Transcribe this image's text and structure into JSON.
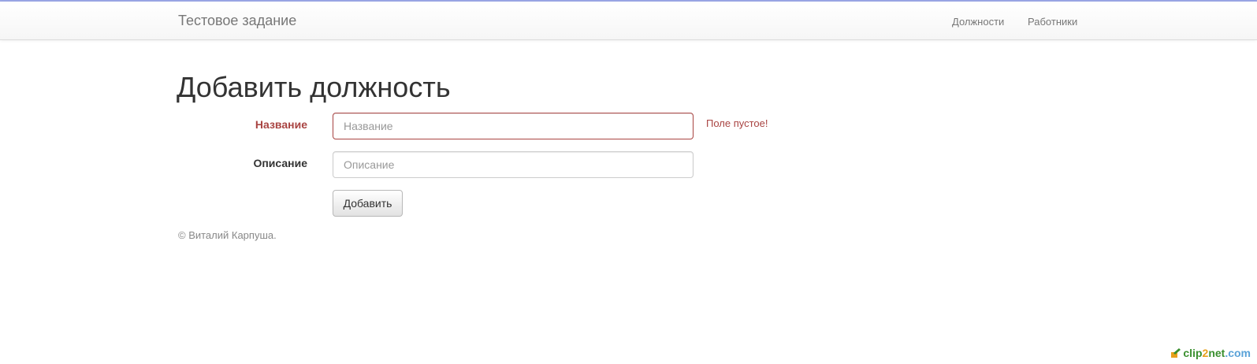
{
  "navbar": {
    "brand": "Тестовое задание",
    "links": [
      {
        "label": "Должности"
      },
      {
        "label": "Работники"
      }
    ]
  },
  "page": {
    "title": "Добавить должность"
  },
  "form": {
    "name": {
      "label": "Название",
      "placeholder": "Название",
      "value": "",
      "error": "Поле пустое!"
    },
    "description": {
      "label": "Описание",
      "placeholder": "Описание",
      "value": ""
    },
    "submit_label": "Добавить"
  },
  "footer": {
    "text": "© Виталий Карпуша."
  },
  "watermark": {
    "clip": "clip",
    "two": "2",
    "net": "net",
    "com": ".com"
  },
  "colors": {
    "error": "#a94442",
    "nav_text": "#777777",
    "accent_line": "#9aa6e6"
  }
}
